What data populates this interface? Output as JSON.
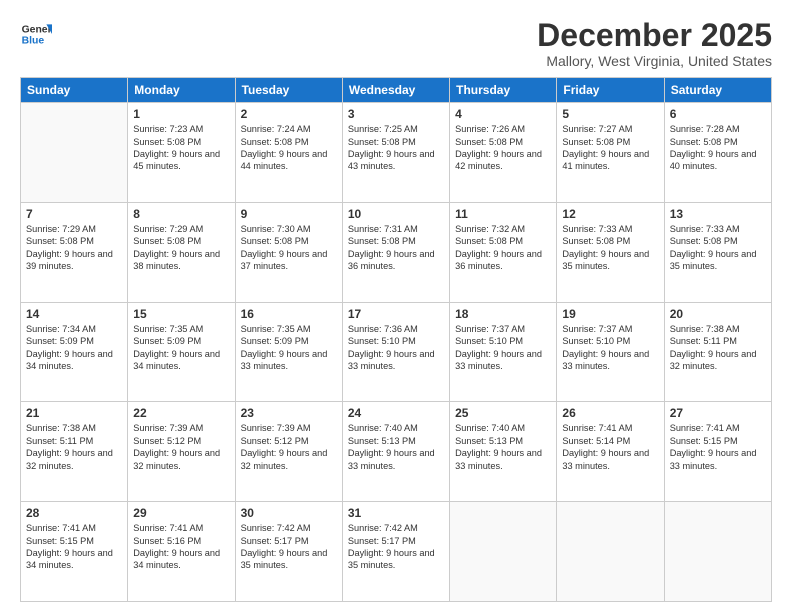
{
  "logo": {
    "line1": "General",
    "line2": "Blue"
  },
  "title": "December 2025",
  "location": "Mallory, West Virginia, United States",
  "weekdays": [
    "Sunday",
    "Monday",
    "Tuesday",
    "Wednesday",
    "Thursday",
    "Friday",
    "Saturday"
  ],
  "weeks": [
    [
      {
        "day": "",
        "info": ""
      },
      {
        "day": "1",
        "info": "Sunrise: 7:23 AM\nSunset: 5:08 PM\nDaylight: 9 hours\nand 45 minutes."
      },
      {
        "day": "2",
        "info": "Sunrise: 7:24 AM\nSunset: 5:08 PM\nDaylight: 9 hours\nand 44 minutes."
      },
      {
        "day": "3",
        "info": "Sunrise: 7:25 AM\nSunset: 5:08 PM\nDaylight: 9 hours\nand 43 minutes."
      },
      {
        "day": "4",
        "info": "Sunrise: 7:26 AM\nSunset: 5:08 PM\nDaylight: 9 hours\nand 42 minutes."
      },
      {
        "day": "5",
        "info": "Sunrise: 7:27 AM\nSunset: 5:08 PM\nDaylight: 9 hours\nand 41 minutes."
      },
      {
        "day": "6",
        "info": "Sunrise: 7:28 AM\nSunset: 5:08 PM\nDaylight: 9 hours\nand 40 minutes."
      }
    ],
    [
      {
        "day": "7",
        "info": "Sunrise: 7:29 AM\nSunset: 5:08 PM\nDaylight: 9 hours\nand 39 minutes."
      },
      {
        "day": "8",
        "info": "Sunrise: 7:29 AM\nSunset: 5:08 PM\nDaylight: 9 hours\nand 38 minutes."
      },
      {
        "day": "9",
        "info": "Sunrise: 7:30 AM\nSunset: 5:08 PM\nDaylight: 9 hours\nand 37 minutes."
      },
      {
        "day": "10",
        "info": "Sunrise: 7:31 AM\nSunset: 5:08 PM\nDaylight: 9 hours\nand 36 minutes."
      },
      {
        "day": "11",
        "info": "Sunrise: 7:32 AM\nSunset: 5:08 PM\nDaylight: 9 hours\nand 36 minutes."
      },
      {
        "day": "12",
        "info": "Sunrise: 7:33 AM\nSunset: 5:08 PM\nDaylight: 9 hours\nand 35 minutes."
      },
      {
        "day": "13",
        "info": "Sunrise: 7:33 AM\nSunset: 5:08 PM\nDaylight: 9 hours\nand 35 minutes."
      }
    ],
    [
      {
        "day": "14",
        "info": "Sunrise: 7:34 AM\nSunset: 5:09 PM\nDaylight: 9 hours\nand 34 minutes."
      },
      {
        "day": "15",
        "info": "Sunrise: 7:35 AM\nSunset: 5:09 PM\nDaylight: 9 hours\nand 34 minutes."
      },
      {
        "day": "16",
        "info": "Sunrise: 7:35 AM\nSunset: 5:09 PM\nDaylight: 9 hours\nand 33 minutes."
      },
      {
        "day": "17",
        "info": "Sunrise: 7:36 AM\nSunset: 5:10 PM\nDaylight: 9 hours\nand 33 minutes."
      },
      {
        "day": "18",
        "info": "Sunrise: 7:37 AM\nSunset: 5:10 PM\nDaylight: 9 hours\nand 33 minutes."
      },
      {
        "day": "19",
        "info": "Sunrise: 7:37 AM\nSunset: 5:10 PM\nDaylight: 9 hours\nand 33 minutes."
      },
      {
        "day": "20",
        "info": "Sunrise: 7:38 AM\nSunset: 5:11 PM\nDaylight: 9 hours\nand 32 minutes."
      }
    ],
    [
      {
        "day": "21",
        "info": "Sunrise: 7:38 AM\nSunset: 5:11 PM\nDaylight: 9 hours\nand 32 minutes."
      },
      {
        "day": "22",
        "info": "Sunrise: 7:39 AM\nSunset: 5:12 PM\nDaylight: 9 hours\nand 32 minutes."
      },
      {
        "day": "23",
        "info": "Sunrise: 7:39 AM\nSunset: 5:12 PM\nDaylight: 9 hours\nand 32 minutes."
      },
      {
        "day": "24",
        "info": "Sunrise: 7:40 AM\nSunset: 5:13 PM\nDaylight: 9 hours\nand 33 minutes."
      },
      {
        "day": "25",
        "info": "Sunrise: 7:40 AM\nSunset: 5:13 PM\nDaylight: 9 hours\nand 33 minutes."
      },
      {
        "day": "26",
        "info": "Sunrise: 7:41 AM\nSunset: 5:14 PM\nDaylight: 9 hours\nand 33 minutes."
      },
      {
        "day": "27",
        "info": "Sunrise: 7:41 AM\nSunset: 5:15 PM\nDaylight: 9 hours\nand 33 minutes."
      }
    ],
    [
      {
        "day": "28",
        "info": "Sunrise: 7:41 AM\nSunset: 5:15 PM\nDaylight: 9 hours\nand 34 minutes."
      },
      {
        "day": "29",
        "info": "Sunrise: 7:41 AM\nSunset: 5:16 PM\nDaylight: 9 hours\nand 34 minutes."
      },
      {
        "day": "30",
        "info": "Sunrise: 7:42 AM\nSunset: 5:17 PM\nDaylight: 9 hours\nand 35 minutes."
      },
      {
        "day": "31",
        "info": "Sunrise: 7:42 AM\nSunset: 5:17 PM\nDaylight: 9 hours\nand 35 minutes."
      },
      {
        "day": "",
        "info": ""
      },
      {
        "day": "",
        "info": ""
      },
      {
        "day": "",
        "info": ""
      }
    ]
  ]
}
